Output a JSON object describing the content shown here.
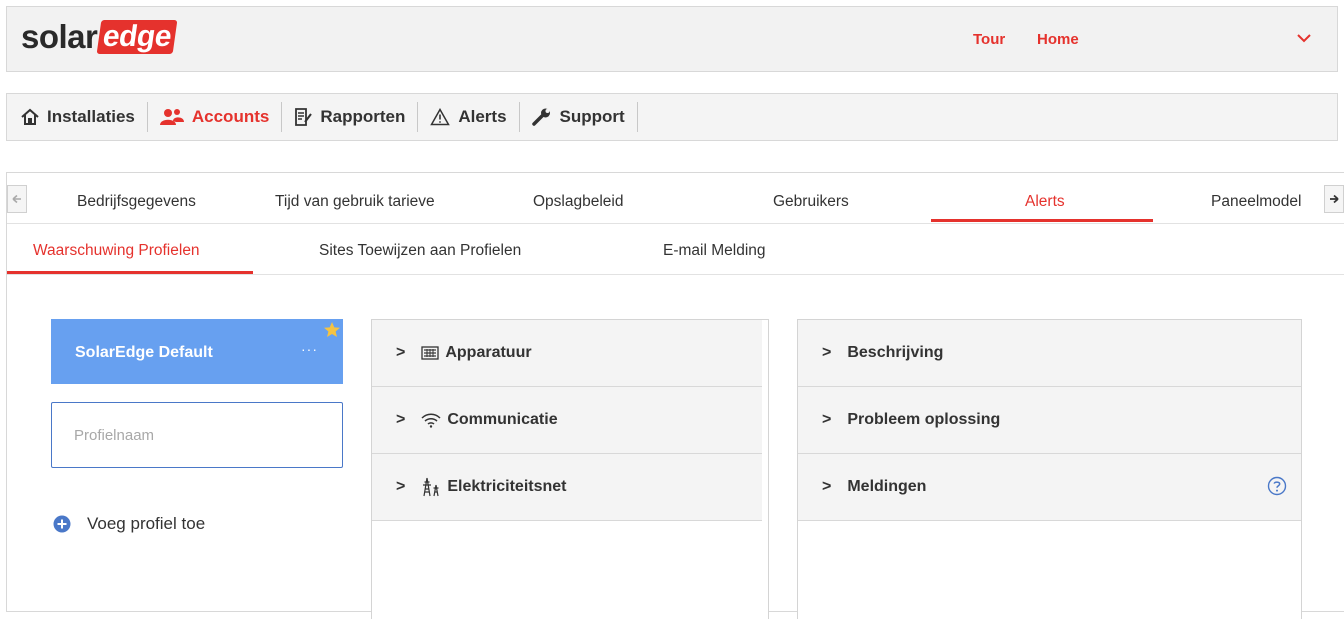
{
  "brand": {
    "solar": "solar",
    "edge": "edge",
    "accent_color": "#e5322d"
  },
  "header": {
    "tour": "Tour",
    "home": "Home",
    "dropdown_icon": "chevron-down-icon"
  },
  "nav": {
    "items": [
      {
        "label": "Installaties",
        "icon": "home-icon"
      },
      {
        "label": "Accounts",
        "icon": "users-icon",
        "active": true
      },
      {
        "label": "Rapporten",
        "icon": "report-icon"
      },
      {
        "label": "Alerts",
        "icon": "warning-icon"
      },
      {
        "label": "Support",
        "icon": "wrench-icon"
      }
    ]
  },
  "tabs": {
    "items": [
      "Bedrijfsgegevens",
      "Tijd van gebruik tarieve",
      "Opslagbeleid",
      "Gebruikers",
      "Alerts",
      "Paneelmodel"
    ],
    "active": "Alerts"
  },
  "subtabs": {
    "items": [
      "Waarschuwing Profielen",
      "Sites Toewijzen aan Profielen",
      "E-mail Melding"
    ],
    "active": "Waarschuwing Profielen"
  },
  "profiles": {
    "default_name": "SolarEdge Default",
    "menu": "···",
    "input_placeholder": "Profielnaam",
    "add_label": "Voeg profiel toe",
    "card_color": "#67a0f0"
  },
  "accordion_left": {
    "items": [
      {
        "label": "Apparatuur",
        "icon": "device-icon"
      },
      {
        "label": "Communicatie",
        "icon": "wifi-icon"
      },
      {
        "label": "Elektriciteitsnet",
        "icon": "power-grid-icon"
      }
    ]
  },
  "accordion_right": {
    "items": [
      {
        "label": "Beschrijving"
      },
      {
        "label": "Probleem oplossing"
      },
      {
        "label": "Meldingen",
        "help_icon": "help-icon"
      }
    ]
  }
}
